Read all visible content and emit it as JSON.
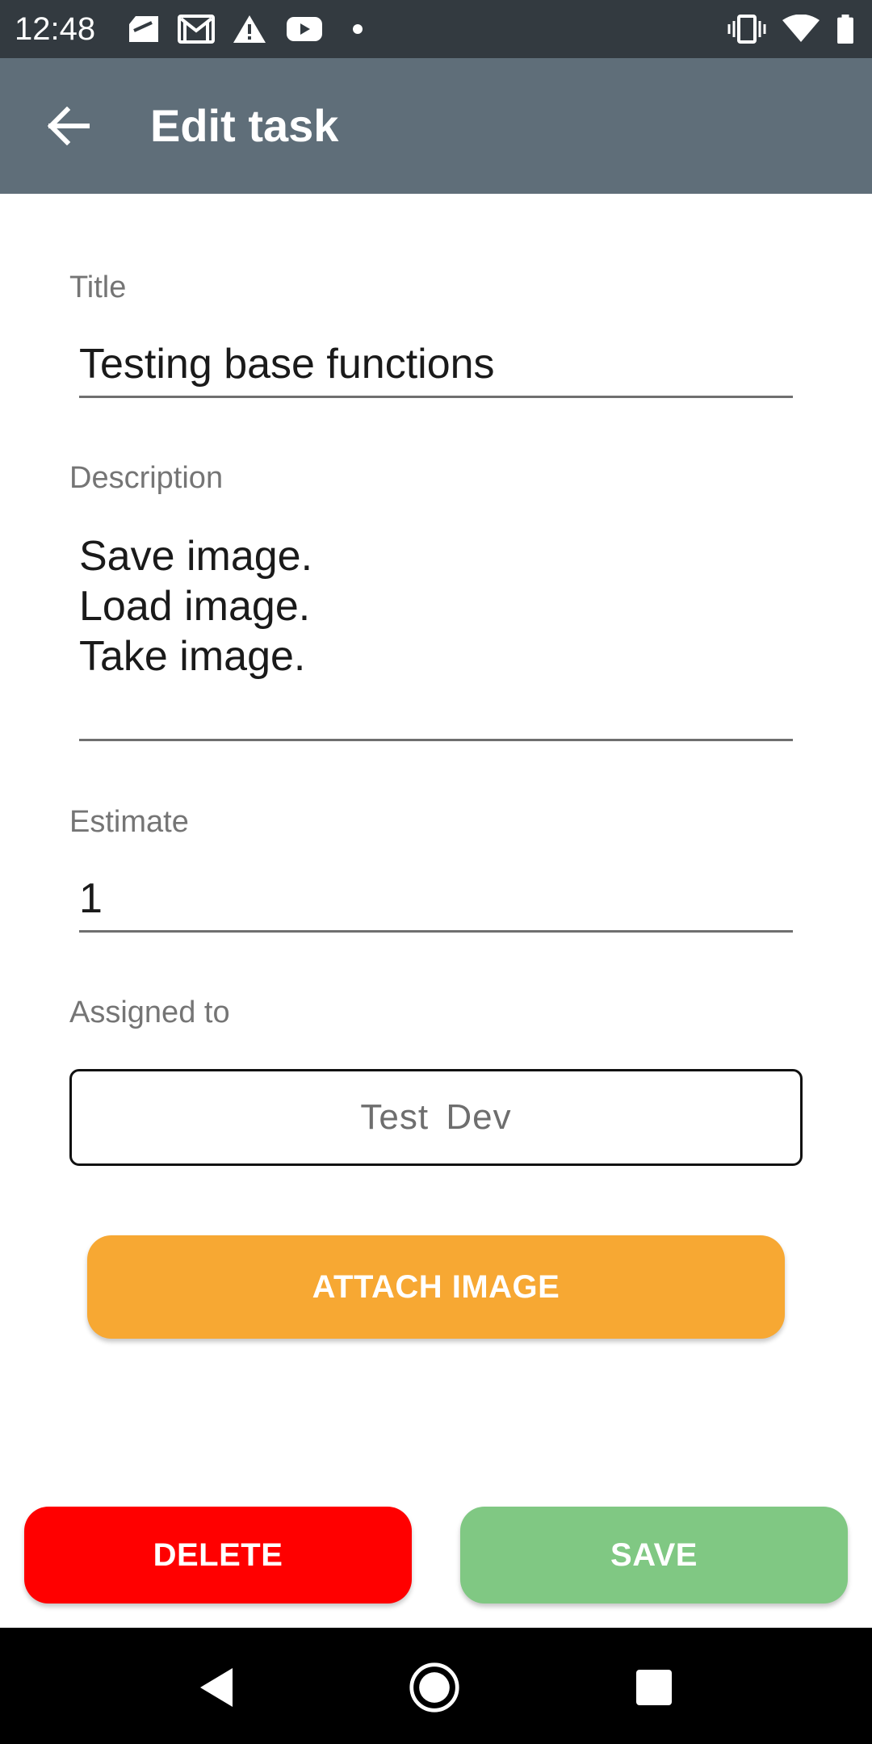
{
  "status_bar": {
    "time": "12:48",
    "left_icons": [
      "sim-card-icon",
      "gmail-icon",
      "warning-icon",
      "youtube-icon",
      "notification-dot-icon"
    ],
    "right_icons": [
      "vibrate-icon",
      "wifi-icon",
      "battery-icon"
    ]
  },
  "app_bar": {
    "title": "Edit task",
    "back_icon": "arrow-back-icon"
  },
  "form": {
    "title_label": "Title",
    "title_value": "Testing base functions",
    "description_label": "Description",
    "description_value": "Save image.\nLoad image.\nTake image.",
    "estimate_label": "Estimate",
    "estimate_value": "1",
    "assigned_label": "Assigned to",
    "assigned_value": "Test  Dev"
  },
  "buttons": {
    "attach": "ATTACH IMAGE",
    "delete": "DELETE",
    "save": "SAVE"
  },
  "colors": {
    "status_bar": "#333a40",
    "app_bar": "#5f6e79",
    "attach": "#f7a833",
    "delete": "#ff0000",
    "save": "#80c883",
    "nav_bar": "#000000"
  },
  "nav_bar": {
    "icons": [
      "back-triangle-icon",
      "home-circle-icon",
      "recents-square-icon"
    ]
  }
}
